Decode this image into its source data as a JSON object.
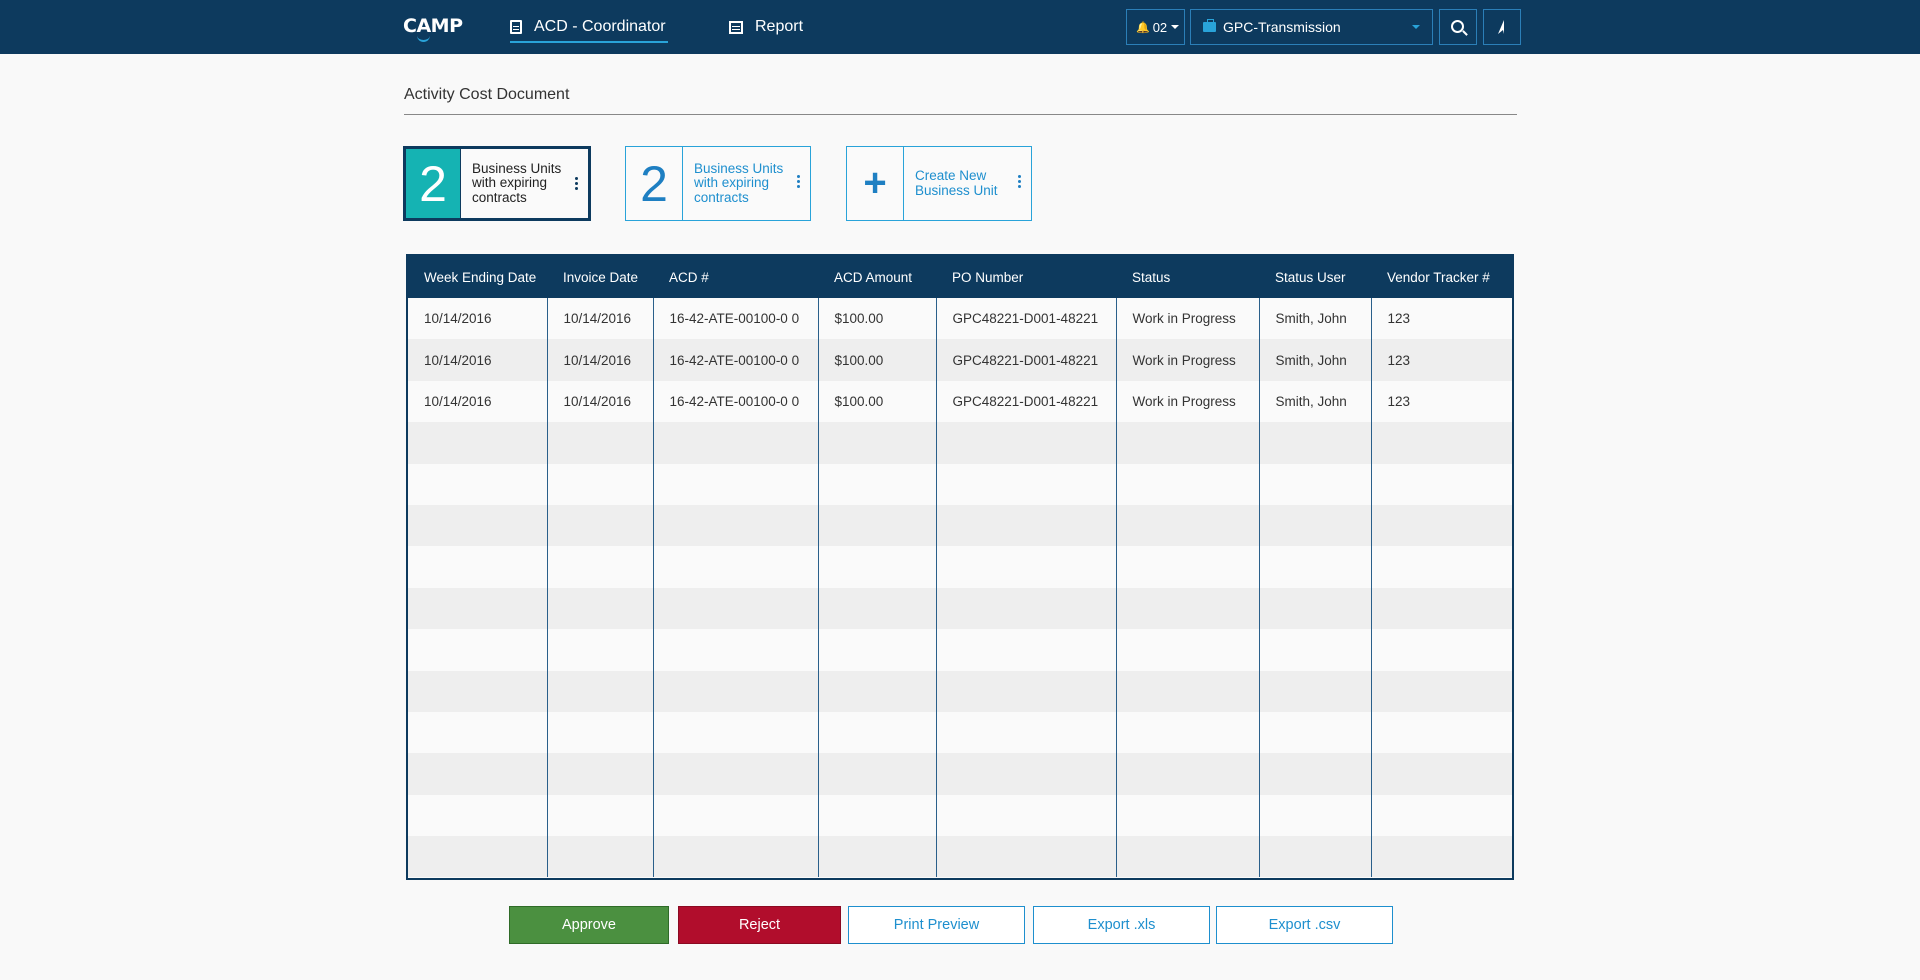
{
  "header": {
    "logo": "CAMP",
    "tabs": [
      {
        "label": "ACD - Coordinator",
        "icon": "document-icon",
        "active": true
      },
      {
        "label": "Report",
        "icon": "calendar-icon",
        "active": false
      }
    ],
    "notifications": {
      "count": "02",
      "icon": "bell-icon"
    },
    "business_unit": {
      "value": "GPC-Transmission",
      "icon": "briefcase-icon"
    },
    "search_icon": "search-icon",
    "nav_icon": "navigation-arrow-icon"
  },
  "page": {
    "title": "Activity Cost Document"
  },
  "cards": [
    {
      "number": "2",
      "label": "Business Units with expiring contracts",
      "selected": true
    },
    {
      "number": "2",
      "label": "Business Units with expiring contracts",
      "selected": false
    },
    {
      "number": "+",
      "label": "Create New Business Unit",
      "selected": false
    }
  ],
  "table": {
    "columns": [
      "Week Ending Date",
      "Invoice Date",
      "ACD #",
      "ACD Amount",
      "PO Number",
      "Status",
      "Status User",
      "Vendor Tracker #"
    ],
    "rows": [
      [
        "10/14/2016",
        "10/14/2016",
        "16-42-ATE-00100-0 0",
        "$100.00",
        "GPC48221-D001-48221",
        "Work in Progress",
        "Smith, John",
        "123"
      ],
      [
        "10/14/2016",
        "10/14/2016",
        "16-42-ATE-00100-0 0",
        "$100.00",
        "GPC48221-D001-48221",
        "Work in Progress",
        "Smith, John",
        "123"
      ],
      [
        "10/14/2016",
        "10/14/2016",
        "16-42-ATE-00100-0 0",
        "$100.00",
        "GPC48221-D001-48221",
        "Work in Progress",
        "Smith, John",
        "123"
      ]
    ],
    "empty_rows": 11
  },
  "actions": {
    "approve": "Approve",
    "reject": "Reject",
    "print_preview": "Print Preview",
    "export_xls": "Export .xls",
    "export_csv": "Export .csv"
  },
  "colors": {
    "nav_bg": "#0d3a5e",
    "accent": "#29a3d9",
    "teal": "#15b3b3",
    "approve": "#4b9040",
    "reject": "#b10d2c"
  }
}
